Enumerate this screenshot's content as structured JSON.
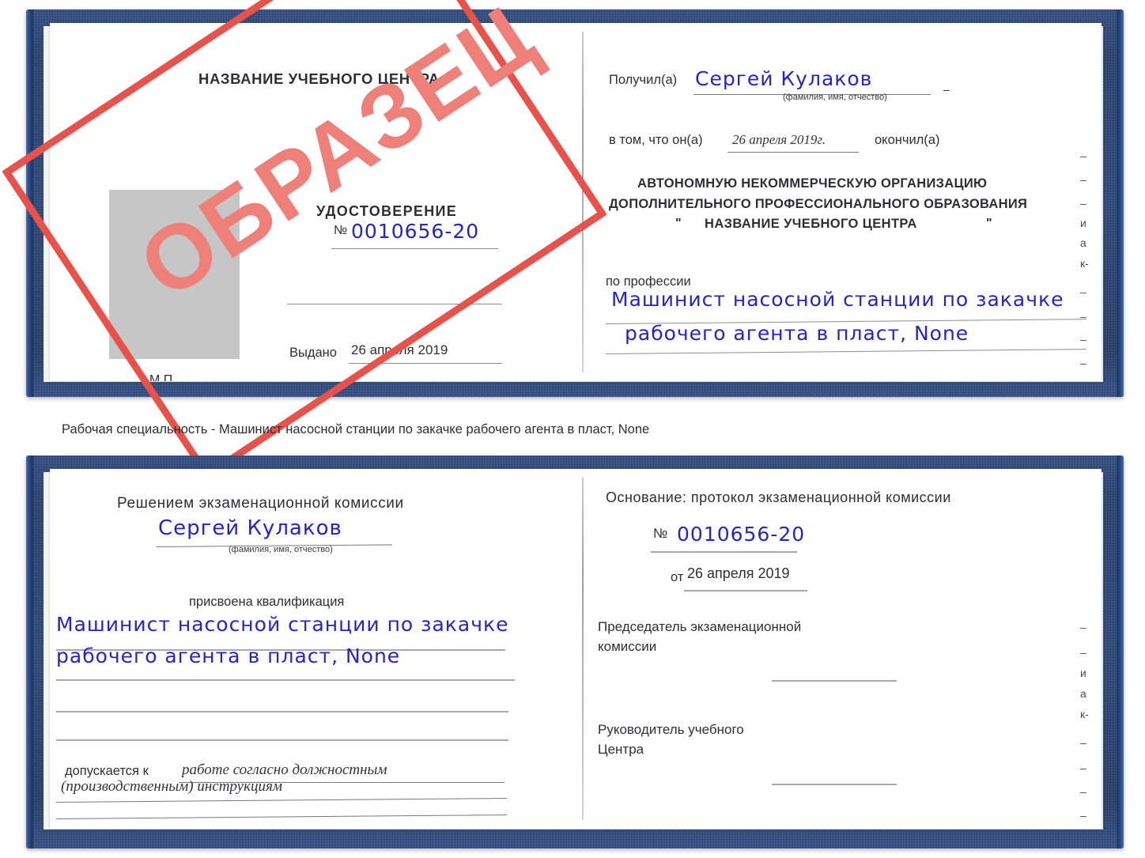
{
  "document": {
    "type": "certificate-booklet-pair",
    "watermark": {
      "text": "ОБРАЗЕЦ",
      "color": "#e8524a"
    },
    "ink_color": "#2323cf",
    "cover_color": "#21406f"
  },
  "caption": {
    "text": "Рабочая специальность - Машинист насосной станции по закачке рабочего агента в пласт, None"
  },
  "cert_top": {
    "left_page": {
      "org_title": "НАЗВАНИЕ УЧЕБНОГО ЦЕНТРА",
      "doc_title": "УДОСТОВЕРЕНИЕ",
      "number_label": "№",
      "number_value": "0010656-20",
      "issued_label": "Выдано",
      "issued_value": "26 апреля 2019",
      "stamp_place": "М.П.",
      "photo_placeholder": "photo-box"
    },
    "right_page": {
      "received_label": "Получил(а)",
      "received_value": "Сергей Кулаков",
      "name_hint": "(фамилия, имя, отчество)",
      "fact_label": "в том, что он(а)",
      "fact_date": "26 апреля 2019г.",
      "fact_label_end": "окончил(а)",
      "org_line1": "АВТОНОМНУЮ НЕКОММЕРЧЕСКУЮ ОРГАНИЗАЦИЮ",
      "org_line2": "ДОПОЛНИТЕЛЬНОГО ПРОФЕССИОНАЛЬНОГО ОБРАЗОВАНИЯ",
      "org_quote_open": "\"",
      "org_line3": "НАЗВАНИЕ УЧЕБНОГО ЦЕНТРА",
      "org_quote_close": "\"",
      "profession_label": "по профессии",
      "profession_line1": "Машинист насосной станции по закачке",
      "profession_line2": "рабочего агента в пласт, None",
      "edge_fragments": [
        "–",
        "–",
        "–",
        "и",
        "а",
        "к-",
        "–",
        "–",
        "–",
        "–"
      ]
    }
  },
  "cert_bottom": {
    "left_page": {
      "heading": "Решением экзаменационной комиссии",
      "name_value": "Сергей Кулаков",
      "name_hint": "(фамилия, имя, отчество)",
      "qualification_label": "присвоена квалификация",
      "qualification_line1": "Машинист насосной станции по закачке",
      "qualification_line2": "рабочего агента в пласт, None",
      "admitted_label": "допускается к",
      "admitted_line1": "работе согласно должностным",
      "admitted_line2": "(производственным) инструкциям"
    },
    "right_page": {
      "basis_label": "Основание: протокол экзаменационной комиссии",
      "number_label": "№",
      "number_value": "0010656-20",
      "date_label": "от",
      "date_value": "26 апреля 2019",
      "chairman_line1": "Председатель экзаменационной",
      "chairman_line2": "комиссии",
      "head_line1": "Руководитель учебного",
      "head_line2": "Центра",
      "edge_fragments": [
        "–",
        "–",
        "и",
        "а",
        "к-",
        "–",
        "–",
        "–",
        "–"
      ]
    }
  }
}
